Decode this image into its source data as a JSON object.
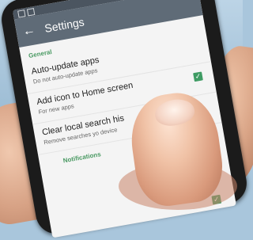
{
  "screen": {
    "title": "Settings",
    "back_icon": "arrow-back-icon",
    "sections": [
      {
        "label": "General"
      },
      {
        "label": "Notifications"
      }
    ],
    "items": [
      {
        "title": "Auto-update apps",
        "subtitle": "Do not auto-update apps",
        "checked": false
      },
      {
        "title": "Add icon to Home screen",
        "subtitle": "For new apps",
        "checked": true
      },
      {
        "title": "Clear local search his",
        "subtitle": "Remove searches yo device",
        "checked": false
      }
    ]
  },
  "colors": {
    "appbar": "#5f6b77",
    "accent": "#3e9b63"
  }
}
